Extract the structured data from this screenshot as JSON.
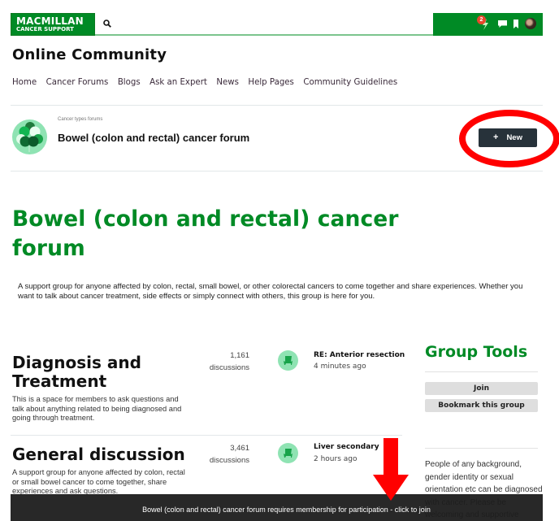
{
  "header": {
    "logo_line1": "MACMILLAN",
    "logo_line2": "CANCER SUPPORT",
    "notification_count": "2",
    "icons": [
      "search-icon",
      "lightning-notification-icon",
      "chat-icon",
      "bookmark-icon",
      "avatar"
    ]
  },
  "site_title": "Online Community",
  "nav": {
    "items": [
      "Home",
      "Cancer Forums",
      "Blogs",
      "Ask an Expert",
      "News",
      "Help Pages",
      "Community Guidelines"
    ]
  },
  "forum_header": {
    "breadcrumb": "Cancer types forums",
    "name": "Bowel (colon and rectal) cancer forum",
    "new_button": {
      "icon": "+",
      "label": "New"
    }
  },
  "page": {
    "title": "Bowel (colon and rectal) cancer forum",
    "description": "A support group for anyone affected by colon, rectal, small bowel, or other colorectal cancers to come together and share experiences. Whether you want to talk about cancer treatment, side effects or simply connect with others, this group is here for you."
  },
  "groups": [
    {
      "title": "Diagnosis and Treatment",
      "description": "This is a space for members to ask questions and talk about anything related to being diagnosed and going through treatment.",
      "count": "1,161",
      "count_label": "discussions",
      "latest_post": "RE: Anterior resection c",
      "latest_time": "4 minutes ago"
    },
    {
      "title": "General discussion",
      "description": "A support group for anyone affected by colon, rectal or small bowel cancer to come together, share experiences and ask questions.",
      "count": "3,461",
      "count_label": "discussions",
      "latest_post": "Liver secondary",
      "latest_time": "2 hours ago"
    }
  ],
  "sidebar": {
    "title": "Group Tools",
    "join_label": "Join",
    "bookmark_label": "Bookmark this group",
    "notice": "People of any background, gender identity or sexual orientation etc can be diagnosed with cancer. Please be welcoming and supportive"
  },
  "banner": {
    "text": "Bowel (colon and rectal) cancer forum requires membership for participation - click to join"
  },
  "colors": {
    "brand_green": "#008a25",
    "icon_mint": "#8fe3b3",
    "new_button_bg": "#27323a",
    "annotation_red": "#ff0000",
    "banner_bg": "#1c1c1c"
  }
}
